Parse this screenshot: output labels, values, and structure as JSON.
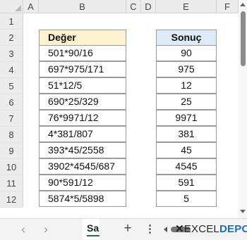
{
  "grid": {
    "columns": [
      "A",
      "B",
      "C",
      "D",
      "E",
      "F"
    ],
    "rows": [
      "1",
      "2",
      "3",
      "4",
      "5",
      "6",
      "7",
      "8",
      "9",
      "10",
      "11",
      "12"
    ]
  },
  "table_deger": {
    "header": "Değer",
    "values": [
      "501*90/16",
      "697*975/171",
      "51*12/5",
      "690*25/329",
      "76*9971/12",
      "4*381/807",
      "393*45/2558",
      "3902*4545/687",
      "90*591/12",
      "5874*5/5898"
    ]
  },
  "table_sonuc": {
    "header": "Sonuç",
    "values": [
      "90",
      "975",
      "12",
      "25",
      "9971",
      "381",
      "45",
      "4545",
      "591",
      "5"
    ]
  },
  "colors": {
    "deger_header_fill": "#fdf2cf",
    "sonuc_header_fill": "#dcebf7",
    "cell_border": "#9a9a9a",
    "active_tab_accent": "#217346",
    "watermark_accent": "#1f6fb5"
  },
  "tabbar": {
    "prev_icon": "‹",
    "next_icon": "›",
    "sheet_tab_label": "Sa",
    "add_icon": "+",
    "more_icon": "⋮"
  },
  "watermark": {
    "mark": "✕",
    "part1": "EXCEL",
    "part2": "DEPO"
  }
}
